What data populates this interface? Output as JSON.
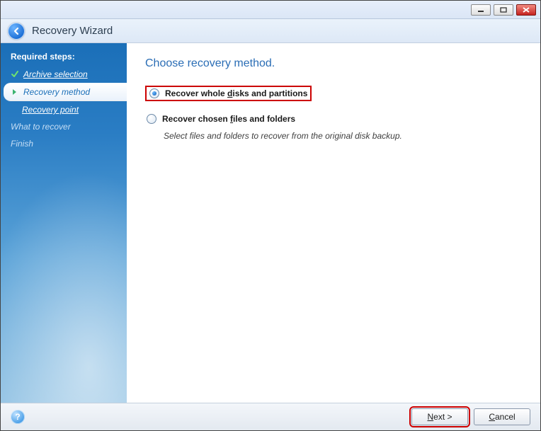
{
  "window": {
    "title": "Recovery Wizard"
  },
  "sidebar": {
    "heading": "Required steps:",
    "steps": [
      {
        "label": "Archive selection",
        "state": "completed"
      },
      {
        "label": "Recovery method",
        "state": "current"
      },
      {
        "label": "Recovery point",
        "state": "sub"
      },
      {
        "label": "What to recover",
        "state": "future"
      },
      {
        "label": "Finish",
        "state": "future"
      }
    ]
  },
  "content": {
    "title": "Choose recovery method.",
    "options": [
      {
        "label_pre": "Recover whole ",
        "label_u": "d",
        "label_post": "isks and partitions",
        "selected": true,
        "highlighted": true
      },
      {
        "label_pre": "Recover chosen ",
        "label_u": "f",
        "label_post": "iles and folders",
        "selected": false,
        "description": "Select files and folders to recover from the original disk backup."
      }
    ]
  },
  "footer": {
    "help": "?",
    "next_pre": "",
    "next_u": "N",
    "next_post": "ext >",
    "cancel_pre": "",
    "cancel_u": "C",
    "cancel_post": "ancel"
  }
}
